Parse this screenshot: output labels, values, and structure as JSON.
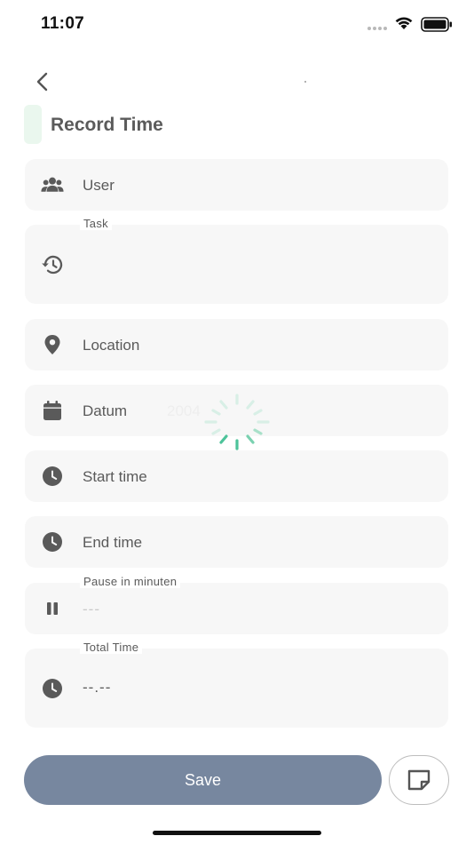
{
  "status_bar": {
    "time": "11:07",
    "icons": [
      "signal-dots",
      "wifi-icon",
      "battery-icon"
    ]
  },
  "header": {
    "back_icon": "chevron-left-icon",
    "title": "Record Time"
  },
  "form": {
    "user": {
      "icon": "users-icon",
      "label": "User"
    },
    "task": {
      "icon": "history-icon",
      "float_label": "Task"
    },
    "location": {
      "icon": "location-pin-icon",
      "label": "Location"
    },
    "date": {
      "icon": "calendar-icon",
      "label": "Datum",
      "faded_value": "2004"
    },
    "start_time": {
      "icon": "clock-icon",
      "label": "Start time"
    },
    "end_time": {
      "icon": "clock-icon",
      "label": "End time"
    },
    "pause": {
      "icon": "pause-icon",
      "float_label": "Pause in minuten",
      "placeholder": "---"
    },
    "total_time": {
      "icon": "clock-icon",
      "float_label": "Total Time",
      "value": "--.--"
    }
  },
  "loading": {
    "icon": "loading-spinner-icon",
    "accent": "#4dc39a"
  },
  "footer": {
    "save_label": "Save",
    "note_icon": "note-icon"
  },
  "colors": {
    "save_button": "#77879f",
    "field_bg": "#f7f7f7",
    "icon": "#5a5a5a"
  }
}
